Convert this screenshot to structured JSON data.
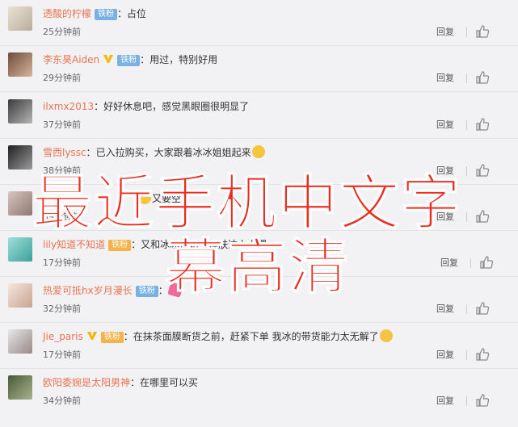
{
  "comments": [
    {
      "user": "透酸的柠檬",
      "badge": "铁粉",
      "badge_style": "blue",
      "vip": false,
      "text": "占位",
      "time": "25分钟前",
      "reply": "回复"
    },
    {
      "user": "李东昊Aiden",
      "badge": "铁粉",
      "badge_style": "blue",
      "vip": true,
      "text": "用过，特别好用",
      "time": "29分钟前",
      "reply": "回复"
    },
    {
      "user": "ilxmx2013",
      "badge": "",
      "badge_style": "",
      "vip": false,
      "text": "好好休息吧，感觉黑眼圈很明显了",
      "time": "37分钟前",
      "reply": "回复"
    },
    {
      "user": "雪西lyssc",
      "badge": "",
      "badge_style": "",
      "vip": false,
      "text": "已入拉购买，大家跟着冰冰姐姐起来",
      "time": "38分钟前",
      "reply": "回复"
    },
    {
      "user": "",
      "badge": "",
      "badge_style": "",
      "vip": false,
      "text": "又要空了",
      "time": "39分钟前",
      "reply": "回复"
    },
    {
      "user": "lily知道不知道",
      "badge": "铁粉",
      "badge_style": "gold",
      "vip": false,
      "text": "又和冰冰姐姐一样肤达上上课",
      "time": "17分钟前",
      "reply": "回复"
    },
    {
      "user": "热爱可抵hx岁月漫长",
      "badge": "铁粉",
      "badge_style": "blue",
      "vip": false,
      "text": "",
      "time": "32分钟前",
      "reply": "回复"
    },
    {
      "user": "Jie_paris",
      "badge": "铁粉",
      "badge_style": "gold",
      "vip": true,
      "text": "在抹茶面膜断货之前，赶紧下单 我冰的带货能力太无解了",
      "time": "17分钟前",
      "reply": "回复"
    },
    {
      "user": "欧阳委婉是太阳男神",
      "badge": "",
      "badge_style": "",
      "vip": false,
      "text": "在哪里可以买",
      "time": "34分钟前",
      "reply": "回复"
    }
  ],
  "overlay": {
    "line1": "最近手机中文字",
    "line2": "幕高清"
  },
  "colors": {
    "username": "#eb7350",
    "overlay_text": "#ed2b1e",
    "background": "#f2f2f5"
  }
}
